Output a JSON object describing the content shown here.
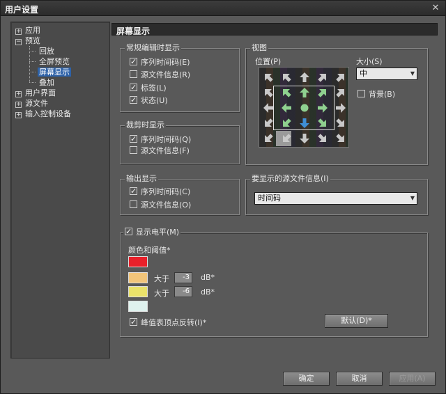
{
  "window": {
    "title": "用户设置",
    "close_glyph": "✕"
  },
  "tree": {
    "items": [
      {
        "label": "应用",
        "expander": "+"
      },
      {
        "label": "预览",
        "expander": "−"
      },
      {
        "label": "回放"
      },
      {
        "label": "全屏预览"
      },
      {
        "label": "屏幕显示",
        "selected": true
      },
      {
        "label": "叠加"
      },
      {
        "label": "用户界面",
        "expander": "+"
      },
      {
        "label": "源文件",
        "expander": "+"
      },
      {
        "label": "输入控制设备",
        "expander": "+"
      }
    ]
  },
  "panel": {
    "title": "屏幕显示"
  },
  "edit_group": {
    "title": "常规编辑时显示",
    "options": [
      {
        "label": "序列时间码(E)",
        "checked": true
      },
      {
        "label": "源文件信息(R)",
        "checked": false
      },
      {
        "label": "标签(L)",
        "checked": true
      },
      {
        "label": "状态(U)",
        "checked": true
      }
    ]
  },
  "trim_group": {
    "title": "裁剪时显示",
    "options": [
      {
        "label": "序列时间码(Q)",
        "checked": true
      },
      {
        "label": "源文件信息(F)",
        "checked": false
      }
    ]
  },
  "output_group": {
    "title": "输出显示",
    "options": [
      {
        "label": "序列时间码(C)",
        "checked": true
      },
      {
        "label": "源文件信息(O)",
        "checked": false
      }
    ]
  },
  "view_group": {
    "title": "视图",
    "position_label": "位置(P)",
    "size_label": "大小(S)",
    "size_value": "中",
    "background_label": "背景(B)",
    "background_checked": false,
    "selected_position": "bottom-center"
  },
  "source_info_group": {
    "title": "要显示的源文件信息(I)",
    "value": "时间码"
  },
  "level_group": {
    "title": "显示电平(M)",
    "checked": true,
    "color_label": "颜色和阈值*",
    "swatches": [
      "#e8202a",
      "#f2c57a",
      "#eae26a",
      "#dff2ee"
    ],
    "threshold1_prefix": "大于",
    "threshold1_value": "-3",
    "threshold1_unit": "dB*",
    "threshold2_prefix": "大于",
    "threshold2_value": "-6",
    "threshold2_unit": "dB*",
    "peak_label": "峰值表顶点反转(I)*",
    "peak_checked": true,
    "default_button": "默认(D)*"
  },
  "buttons": {
    "ok": "确定",
    "cancel": "取消",
    "apply": "应用(A)"
  },
  "colors": {
    "panel_bg": "#595959",
    "tree_selection": "#2e62a8",
    "arrow_fill": "#c9c9c9",
    "arrow_selected": "#3f8fd6",
    "arrow_inner": "#8fd08f"
  }
}
